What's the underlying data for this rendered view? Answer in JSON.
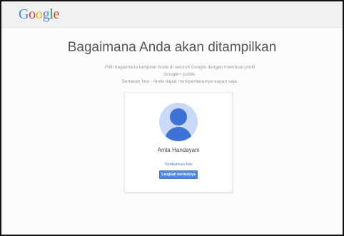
{
  "header": {
    "logo_letters": [
      {
        "char": "G",
        "color": "#4285f4"
      },
      {
        "char": "o",
        "color": "#db4437"
      },
      {
        "char": "o",
        "color": "#f4b400"
      },
      {
        "char": "g",
        "color": "#4285f4"
      },
      {
        "char": "l",
        "color": "#0f9d58"
      },
      {
        "char": "e",
        "color": "#db4437"
      }
    ]
  },
  "main": {
    "title": "Bagaimana Anda akan ditampilkan",
    "subtitle_line1": "Pilih bagaimana tampilan Anda di seluruh Google dengan membuat profil",
    "subtitle_line2": "Google+ publik.",
    "subtitle_line3": "Sertakan foto - Anda dapat memperbaruinya kapan saja."
  },
  "card": {
    "name": "Anita Handayani",
    "add_photo_label": "Tambahkan foto",
    "next_button_label": "Langkah berikutnya"
  },
  "colors": {
    "accent": "#4d88ea",
    "avatar_bg": "#c9daf8",
    "avatar_fg": "#3f72d6"
  }
}
